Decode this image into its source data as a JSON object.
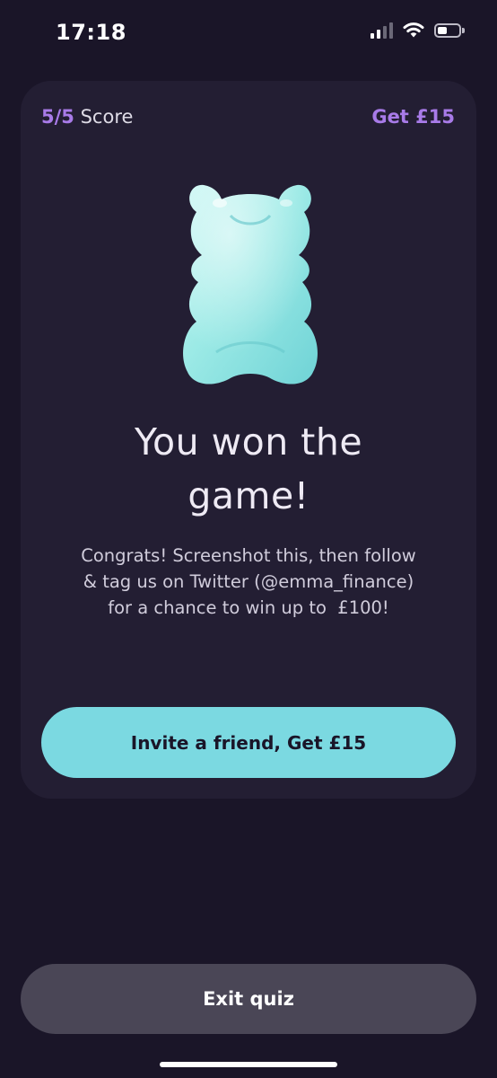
{
  "status_bar": {
    "time": "17:18",
    "icons": [
      "signal-icon",
      "wifi-icon",
      "battery-icon"
    ],
    "battery_level": 0.45
  },
  "header": {
    "score_value": "5/5",
    "score_label": "Score",
    "reward_link": "Get £15"
  },
  "result": {
    "image": "gummy-bear-icon",
    "headline_line1": "You won the",
    "headline_line2": "game!",
    "message_line1": "Congrats! Screenshot this, then follow",
    "message_line2": "& tag us on Twitter (@emma_finance)",
    "message_line3": "for a chance to win up to  £100!"
  },
  "actions": {
    "invite_label": "Invite a friend, Get £15",
    "exit_label": "Exit quiz"
  },
  "colors": {
    "background": "#1a1528",
    "card": "#231e33",
    "accent_purple": "#a87be8",
    "accent_teal": "#7bd9e1",
    "exit_button": "#4a4656"
  }
}
